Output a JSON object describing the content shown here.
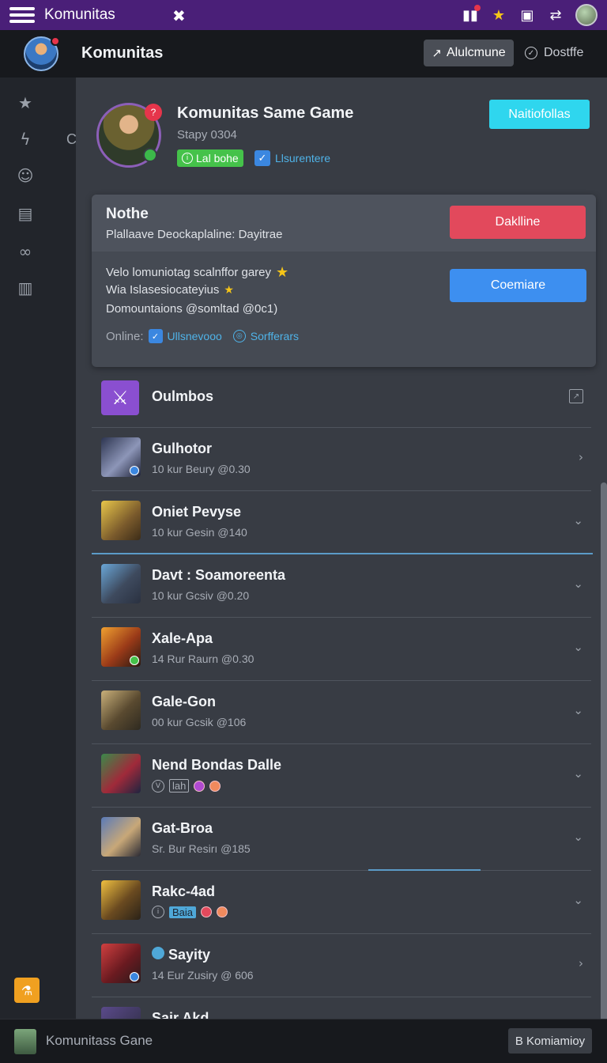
{
  "topbar": {
    "title": "Komunitas",
    "gamepad_icon": "✖",
    "icons": [
      "chart-icon",
      "star-icon",
      "tablet-icon",
      "share-icon"
    ]
  },
  "header": {
    "name": "Komunitas",
    "primary_button": "Alulcmune",
    "secondary_button": "Dostffe"
  },
  "rail": {
    "items": [
      "star-icon",
      "bolt-icon",
      "robot-icon",
      "server-icon",
      "link-icon",
      "stats-icon"
    ],
    "partial_letter": "C",
    "bottom_icon": "beaker-icon"
  },
  "profile": {
    "title": "Komunitas Same Game",
    "subtitle": "Stapy 0304",
    "notif_count": "?",
    "tag_green": "Lal bohe",
    "tag_check": "Llsurentere",
    "action_button": "Naitiofollas"
  },
  "card": {
    "title": "Nothe",
    "subtitle": "Plallaave Deockaplaline: Dayitrae",
    "primary_button": "Daklline",
    "secondary_button": "Coemiare",
    "lines": [
      "Velo lomuniotag scalnffor garey",
      "Wia Islasesiocateyius",
      "Domountaions @somltad @0c1)"
    ],
    "online_label": "Online:",
    "online_v1": "Ullsnevooo",
    "online_v2": "Sorfferars"
  },
  "list": {
    "header": "Oulmbos",
    "rows": [
      {
        "name": "Gulhotor",
        "meta": "10 kur Beury @0.30",
        "chevron": "›"
      },
      {
        "name": "Oniet Pevyse",
        "meta": "10 kur Gesin @140",
        "chevron": "⌄"
      },
      {
        "name": "Davt : Soamoreenta",
        "meta": "10 kur Gcsiv @0.20",
        "chevron": "⌄"
      },
      {
        "name": "Xale-Apa",
        "meta": "14 Rur Raurn @0.30",
        "chevron": "⌄"
      },
      {
        "name": "Gale-Gon",
        "meta": "00 kur Gcsik @106",
        "chevron": "⌄"
      },
      {
        "name": "Nend Bondas Dalle",
        "meta_tag": "lah",
        "chevron": "⌄"
      },
      {
        "name": "Gat-Broa",
        "meta": "Sr. Bur Resirı @185",
        "chevron": "⌄"
      },
      {
        "name": "Rakc-4ad",
        "meta_tag": "Baia",
        "chevron": "⌄"
      },
      {
        "name": "Sayity",
        "meta": "14 Eur Zusiry @ 606",
        "chevron": "›"
      },
      {
        "name": "Sair Akd"
      }
    ]
  },
  "bottombar": {
    "title": "Komunitass Gane",
    "button": "B Komiamioy"
  },
  "colors": {
    "topbar": "#4a1f78",
    "accent_cyan": "#2fd6ee",
    "accent_red": "#e2495c",
    "accent_blue": "#3d8ff0",
    "accent_green": "#45c24a"
  }
}
